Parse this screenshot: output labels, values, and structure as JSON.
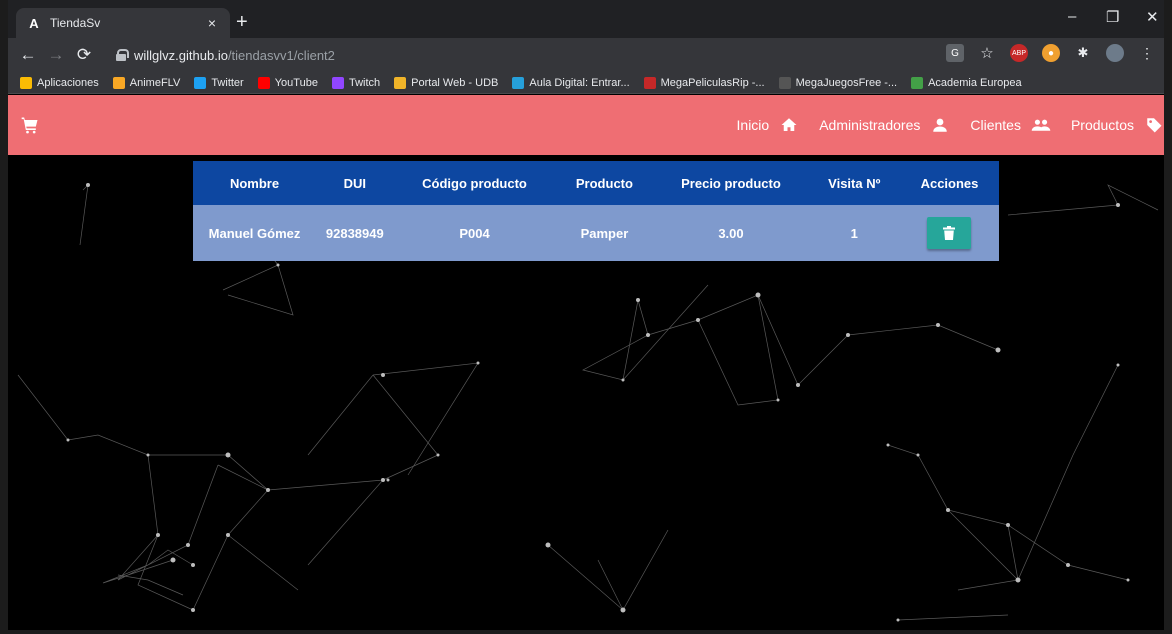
{
  "browser": {
    "tab_title": "TiendaSv",
    "tab_favicon": "A",
    "tab_close": "×",
    "new_tab": "+",
    "url_host": "willglvz.github.io",
    "url_path": "/tiendasvv1/client2",
    "minimize": "–",
    "restore": "❐",
    "close": "✕"
  },
  "bookmarks": [
    {
      "label": "Aplicaciones",
      "icon": "apps-grid-icon",
      "color": "#fbbc04"
    },
    {
      "label": "AnimeFLV",
      "icon": "animeflv-icon",
      "color": "#f9a825"
    },
    {
      "label": "Twitter",
      "icon": "twitter-icon",
      "color": "#1da1f2"
    },
    {
      "label": "YouTube",
      "icon": "youtube-icon",
      "color": "#ff0000"
    },
    {
      "label": "Twitch",
      "icon": "twitch-icon",
      "color": "#9146ff"
    },
    {
      "label": "Portal Web - UDB",
      "icon": "udb-icon",
      "color": "#f0b429"
    },
    {
      "label": "Aula Digital: Entrar...",
      "icon": "aula-digital-icon",
      "color": "#26a0da"
    },
    {
      "label": "MegaPeliculasRip -...",
      "icon": "megapeliculas-icon",
      "color": "#c62828"
    },
    {
      "label": "MegaJuegosFree -...",
      "icon": "megajuegos-icon",
      "color": "#555555"
    },
    {
      "label": "Academia Europea",
      "icon": "academia-icon",
      "color": "#43a047"
    }
  ],
  "nav": {
    "inicio": "Inicio",
    "administradores": "Administradores",
    "clientes": "Clientes",
    "productos": "Productos"
  },
  "table": {
    "headers": [
      "Nombre",
      "DUI",
      "Código producto",
      "Producto",
      "Precio producto",
      "Visita Nº",
      "Acciones"
    ],
    "rows": [
      {
        "nombre": "Manuel Gómez",
        "dui": "92838949",
        "codigo": "P004",
        "producto": "Pamper",
        "precio": "3.00",
        "visita": "1"
      }
    ]
  },
  "colors": {
    "navbar": "#ef6e73",
    "table_header": "#0d47a1",
    "table_row": "#7f9acd",
    "delete_button": "#26a69a"
  }
}
